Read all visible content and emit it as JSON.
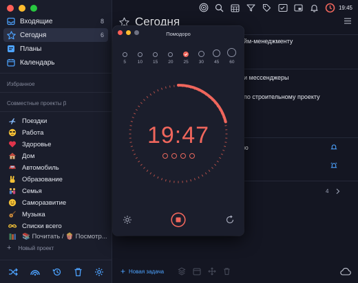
{
  "window": {
    "controls": [
      "#ff5f57",
      "#febc2e",
      "#28c840"
    ]
  },
  "sidebar": {
    "nav": [
      {
        "name": "inbox",
        "label": "Входящие",
        "count": "8",
        "icon": "inbox-icon",
        "color": "#4da3ff"
      },
      {
        "name": "today",
        "label": "Сегодня",
        "count": "6",
        "icon": "star-icon",
        "color": "#4da3ff",
        "active": true
      },
      {
        "name": "plans",
        "label": "Планы",
        "count": "",
        "icon": "plans-icon",
        "color": "#4da3ff"
      },
      {
        "name": "calendar",
        "label": "Календарь",
        "count": "",
        "icon": "calendar-icon",
        "color": "#4da3ff"
      }
    ],
    "favorites_title": "Избранное",
    "shared_title": "Совместные проекты β",
    "projects": [
      {
        "label": "Поездки",
        "icon": "airplane-icon",
        "color": "#5a8fd6"
      },
      {
        "label": "Работа",
        "icon": "face-sunglasses-icon",
        "color": "#f2c037"
      },
      {
        "label": "Здоровье",
        "icon": "heart-icon",
        "color": "#e0344b"
      },
      {
        "label": "Дом",
        "icon": "house-icon",
        "color": "#c9a26d"
      },
      {
        "label": "Автомобиль",
        "icon": "car-icon",
        "color": "#d14848"
      },
      {
        "label": "Образование",
        "icon": "victory-hand-icon",
        "color": "#f2c037"
      },
      {
        "label": "Семья",
        "icon": "family-icon",
        "color": "#e6b656"
      },
      {
        "label": "Саморазвитие",
        "icon": "face-smile-icon",
        "color": "#f2c037"
      },
      {
        "label": "Музыка",
        "icon": "guitar-icon",
        "color": "#c98a3e"
      },
      {
        "label": "Списки всего",
        "icon": "infinity-icon",
        "color": "#f2c037"
      },
      {
        "label": "📚 Почитать / 🍿 Посмотр...",
        "icon": "books-icon",
        "color": "#4ca36b"
      }
    ],
    "new_project": "Новый проект"
  },
  "toolbar": {
    "time": "19:45"
  },
  "main": {
    "title": "Сегодня",
    "rows": [
      "йм-менеджменту",
      "и мессенджеры",
      "по строительному проекту",
      "ю",
      "4"
    ],
    "add_task": "Новая задача"
  },
  "pomodoro": {
    "title": "Помодоро",
    "presets": [
      "5",
      "10",
      "15",
      "20",
      "25",
      "30",
      "45",
      "60"
    ],
    "selected_preset": "25",
    "time": "19:47",
    "sessions": 4,
    "progress": 0.21,
    "accent": "#f0665c"
  }
}
